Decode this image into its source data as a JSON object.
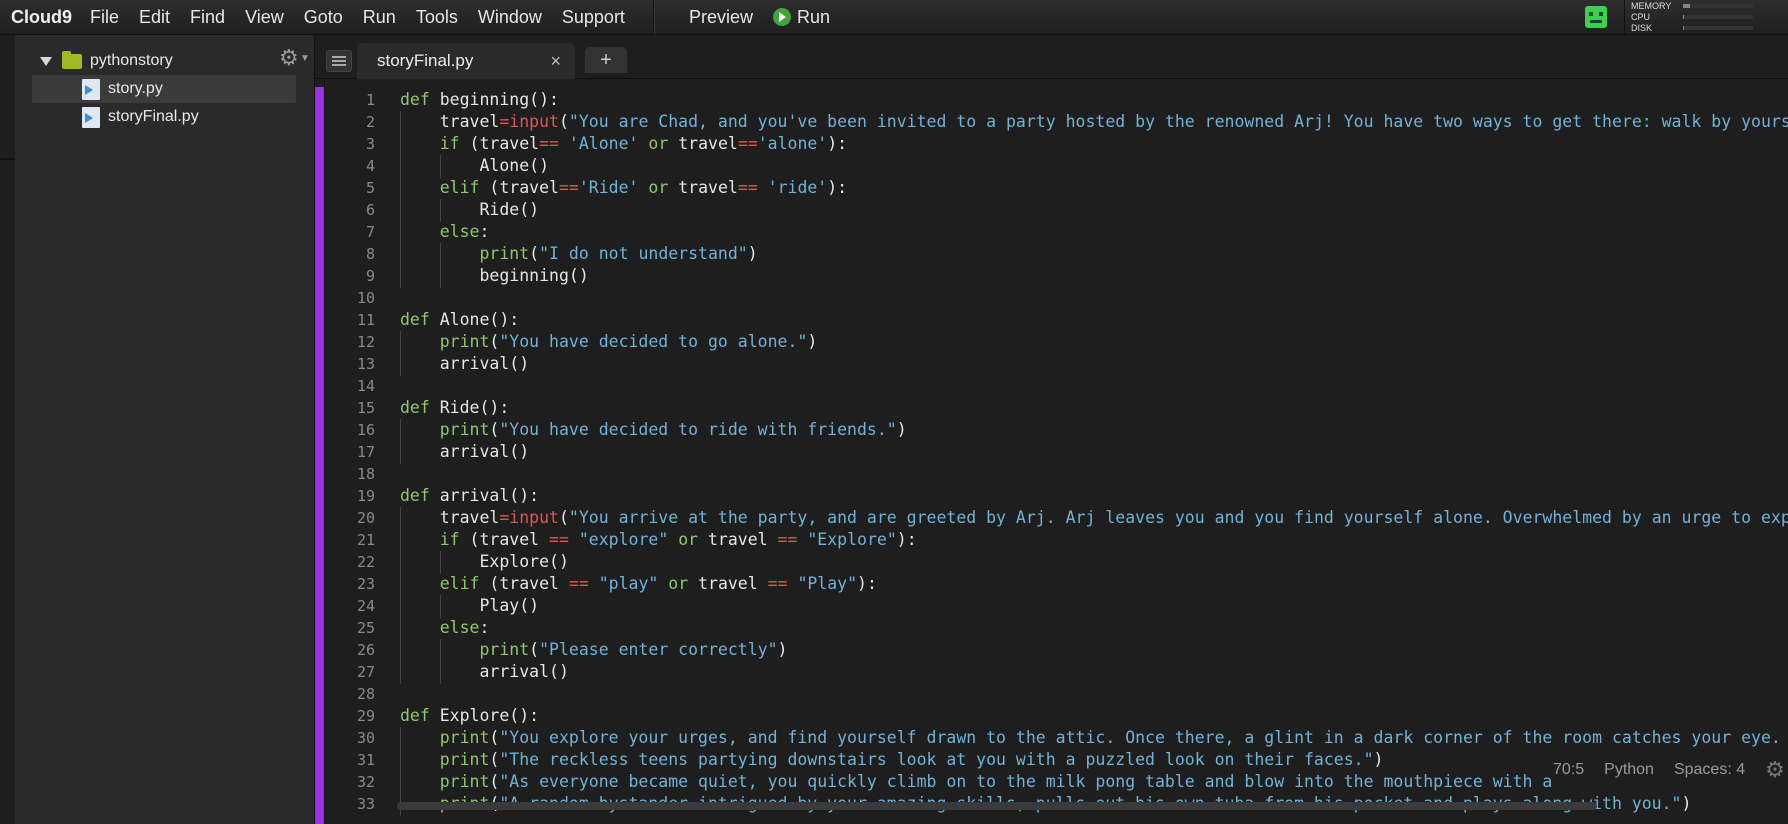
{
  "app": {
    "name": "Cloud9",
    "menu": [
      "File",
      "Edit",
      "Find",
      "View",
      "Goto",
      "Run",
      "Tools",
      "Window",
      "Support"
    ],
    "preview_label": "Preview",
    "run_label": "Run"
  },
  "stats": {
    "memory_label": "MEMORY",
    "cpu_label": "CPU",
    "disk_label": "DISK",
    "memory_level": 0.1,
    "cpu_level": 0.02,
    "disk_level": 0.02
  },
  "tree": {
    "folder": "pythonstory",
    "files": [
      "story.py",
      "storyFinal.py"
    ]
  },
  "tabs": {
    "active": "storyFinal.py",
    "close": "×",
    "add": "+"
  },
  "status": {
    "position": "70:5",
    "language": "Python",
    "indent": "Spaces: 4"
  },
  "code_lines": [
    [
      [
        "kw",
        "def"
      ],
      [
        "t",
        " beginning():"
      ]
    ],
    [
      [
        "g",
        "    "
      ],
      [
        "t",
        "travel"
      ],
      [
        "op",
        "="
      ],
      [
        "op",
        "input"
      ],
      [
        "t",
        "("
      ],
      [
        "str",
        "\"You are Chad, and you've been invited to a party hosted by the renowned Arj! You have two ways to get there: walk by yourse"
      ]
    ],
    [
      [
        "g",
        "    "
      ],
      [
        "kw",
        "if"
      ],
      [
        "t",
        " (travel"
      ],
      [
        "op",
        "=="
      ],
      [
        "t",
        " "
      ],
      [
        "str",
        "'Alone'"
      ],
      [
        "t",
        " "
      ],
      [
        "kw",
        "or"
      ],
      [
        "t",
        " travel"
      ],
      [
        "op",
        "=="
      ],
      [
        "str",
        "'alone'"
      ],
      [
        "t",
        "):"
      ]
    ],
    [
      [
        "g",
        "    "
      ],
      [
        "g",
        "    "
      ],
      [
        "t",
        "Alone()"
      ]
    ],
    [
      [
        "g",
        "    "
      ],
      [
        "kw",
        "elif"
      ],
      [
        "t",
        " (travel"
      ],
      [
        "op",
        "=="
      ],
      [
        "str",
        "'Ride'"
      ],
      [
        "t",
        " "
      ],
      [
        "kw",
        "or"
      ],
      [
        "t",
        " travel"
      ],
      [
        "op",
        "=="
      ],
      [
        "t",
        " "
      ],
      [
        "str",
        "'ride'"
      ],
      [
        "t",
        "):"
      ]
    ],
    [
      [
        "g",
        "    "
      ],
      [
        "g",
        "    "
      ],
      [
        "t",
        "Ride()"
      ]
    ],
    [
      [
        "g",
        "    "
      ],
      [
        "kw",
        "else"
      ],
      [
        "t",
        ":"
      ]
    ],
    [
      [
        "g",
        "    "
      ],
      [
        "g",
        "    "
      ],
      [
        "kw",
        "print"
      ],
      [
        "t",
        "("
      ],
      [
        "str",
        "\"I do not understand\""
      ],
      [
        "t",
        ")"
      ]
    ],
    [
      [
        "g",
        "    "
      ],
      [
        "g",
        "    "
      ],
      [
        "t",
        "beginning()"
      ]
    ],
    [],
    [
      [
        "kw",
        "def"
      ],
      [
        "t",
        " Alone():"
      ]
    ],
    [
      [
        "g",
        "    "
      ],
      [
        "kw",
        "print"
      ],
      [
        "t",
        "("
      ],
      [
        "str",
        "\"You have decided to go alone.\""
      ],
      [
        "t",
        ")"
      ]
    ],
    [
      [
        "g",
        "    "
      ],
      [
        "t",
        "arrival()"
      ]
    ],
    [],
    [
      [
        "kw",
        "def"
      ],
      [
        "t",
        " Ride():"
      ]
    ],
    [
      [
        "g",
        "    "
      ],
      [
        "kw",
        "print"
      ],
      [
        "t",
        "("
      ],
      [
        "str",
        "\"You have decided to ride with friends.\""
      ],
      [
        "t",
        ")"
      ]
    ],
    [
      [
        "g",
        "    "
      ],
      [
        "t",
        "arrival()"
      ]
    ],
    [],
    [
      [
        "kw",
        "def"
      ],
      [
        "t",
        " arrival():"
      ]
    ],
    [
      [
        "g",
        "    "
      ],
      [
        "t",
        "travel"
      ],
      [
        "op",
        "="
      ],
      [
        "op",
        "input"
      ],
      [
        "t",
        "("
      ],
      [
        "str",
        "\"You arrive at the party, and are greeted by Arj. Arj leaves you and you find yourself alone. Overwhelmed by an urge to expl"
      ]
    ],
    [
      [
        "g",
        "    "
      ],
      [
        "kw",
        "if"
      ],
      [
        "t",
        " (travel "
      ],
      [
        "op",
        "=="
      ],
      [
        "t",
        " "
      ],
      [
        "str",
        "\"explore\""
      ],
      [
        "t",
        " "
      ],
      [
        "kw",
        "or"
      ],
      [
        "t",
        " travel "
      ],
      [
        "op",
        "=="
      ],
      [
        "t",
        " "
      ],
      [
        "str",
        "\"Explore\""
      ],
      [
        "t",
        "):"
      ]
    ],
    [
      [
        "g",
        "    "
      ],
      [
        "g",
        "    "
      ],
      [
        "t",
        "Explore()"
      ]
    ],
    [
      [
        "g",
        "    "
      ],
      [
        "kw",
        "elif"
      ],
      [
        "t",
        " (travel "
      ],
      [
        "op",
        "=="
      ],
      [
        "t",
        " "
      ],
      [
        "str",
        "\"play\""
      ],
      [
        "t",
        " "
      ],
      [
        "kw",
        "or"
      ],
      [
        "t",
        " travel "
      ],
      [
        "op",
        "=="
      ],
      [
        "t",
        " "
      ],
      [
        "str",
        "\"Play\""
      ],
      [
        "t",
        "):"
      ]
    ],
    [
      [
        "g",
        "    "
      ],
      [
        "g",
        "    "
      ],
      [
        "t",
        "Play()"
      ]
    ],
    [
      [
        "g",
        "    "
      ],
      [
        "kw",
        "else"
      ],
      [
        "t",
        ":"
      ]
    ],
    [
      [
        "g",
        "    "
      ],
      [
        "g",
        "    "
      ],
      [
        "kw",
        "print"
      ],
      [
        "t",
        "("
      ],
      [
        "str",
        "\"Please enter correctly\""
      ],
      [
        "t",
        ")"
      ]
    ],
    [
      [
        "g",
        "    "
      ],
      [
        "g",
        "    "
      ],
      [
        "t",
        "arrival()"
      ]
    ],
    [],
    [
      [
        "kw",
        "def"
      ],
      [
        "t",
        " Explore():"
      ]
    ],
    [
      [
        "g",
        "    "
      ],
      [
        "kw",
        "print"
      ],
      [
        "t",
        "("
      ],
      [
        "str",
        "\"You explore your urges, and find yourself drawn to the attic. Once there, a glint in a dark corner of the room catches your eye. Y"
      ]
    ],
    [
      [
        "g",
        "    "
      ],
      [
        "kw",
        "print"
      ],
      [
        "t",
        "("
      ],
      [
        "str",
        "\"The reckless teens partying downstairs look at you with a puzzled look on their faces.\""
      ],
      [
        "t",
        ")"
      ]
    ],
    [
      [
        "g",
        "    "
      ],
      [
        "kw",
        "print"
      ],
      [
        "t",
        "("
      ],
      [
        "str",
        "\"As everyone became quiet, you quickly climb on to the milk pong table and blow into the mouthpiece with a"
      ]
    ],
    [
      [
        "g",
        "    "
      ],
      [
        "kw",
        "print"
      ],
      [
        "t",
        "("
      ],
      [
        "str",
        "\"A random bystander intrigued by your amazing skills, pulls out his own tuba from his pocket and plays along with you.\""
      ],
      [
        "t",
        ")"
      ]
    ]
  ]
}
